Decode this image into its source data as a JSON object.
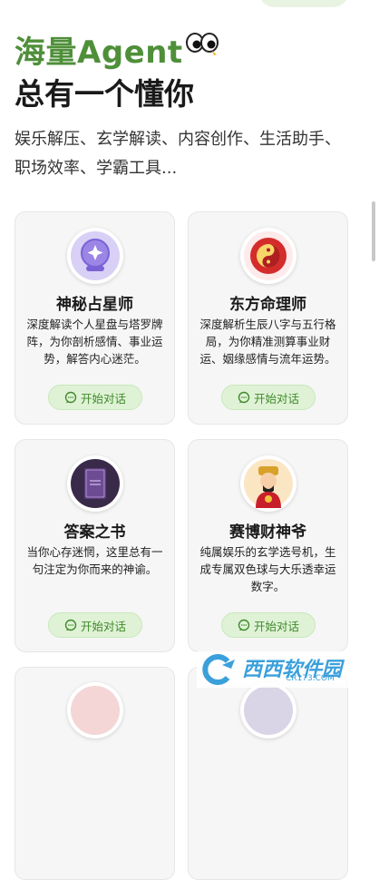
{
  "hero": {
    "title_line1": "海量Agent",
    "title_line2": "总有一个懂你",
    "description": "娱乐解压、玄学解读、内容创作、生活助手、职场效率、学霸工具..."
  },
  "cards": [
    {
      "title": "神秘占星师",
      "description": "深度解读个人星盘与塔罗牌阵，为你剖析感情、事业运势，解答内心迷茫。",
      "button_label": "开始对话",
      "avatar_icon": "crystal-ball-icon"
    },
    {
      "title": "东方命理师",
      "description": "深度解析生辰八字与五行格局，为你精准测算事业财运、姻缘感情与流年运势。",
      "button_label": "开始对话",
      "avatar_icon": "taiji-icon"
    },
    {
      "title": "答案之书",
      "description": "当你心存迷惘，这里总有一句注定为你而来的神谕。",
      "button_label": "开始对话",
      "avatar_icon": "book-icon"
    },
    {
      "title": "赛博财神爷",
      "description": "纯属娱乐的玄学选号机，生成专属双色球与大乐透幸运数字。",
      "button_label": "开始对话",
      "avatar_icon": "god-of-wealth-icon"
    }
  ],
  "watermark": {
    "brand": "西西软件园",
    "url": "CR173.COM"
  },
  "colors": {
    "accent": "#4f8f3a",
    "button_bg": "#dff2d6",
    "button_text": "#3f8a2a",
    "card_bg": "#f6f6f6"
  }
}
